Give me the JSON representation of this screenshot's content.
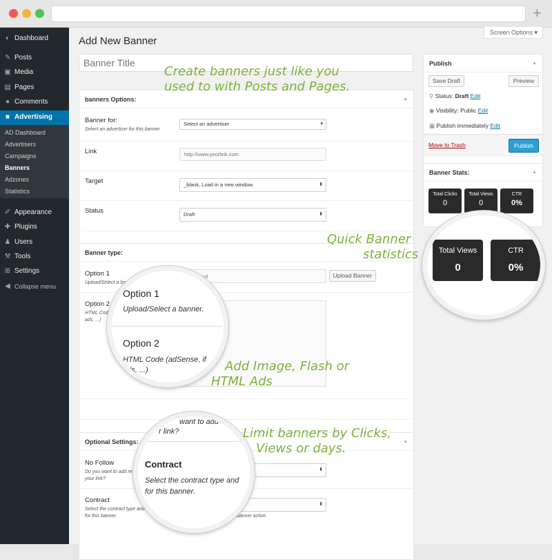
{
  "sidebar": {
    "items": [
      {
        "label": "Dashboard",
        "icon": "dashboard-icon",
        "glyph": "◐"
      },
      {
        "label": "Posts",
        "icon": "pin-icon",
        "glyph": "✎"
      },
      {
        "label": "Media",
        "icon": "media-icon",
        "glyph": "▣"
      },
      {
        "label": "Pages",
        "icon": "pages-icon",
        "glyph": "▤"
      },
      {
        "label": "Comments",
        "icon": "comments-icon",
        "glyph": "●"
      },
      {
        "label": "Advertising",
        "icon": "advertising-icon",
        "glyph": "■"
      },
      {
        "label": "Appearance",
        "icon": "brush-icon",
        "glyph": "✐"
      },
      {
        "label": "Plugins",
        "icon": "plugin-icon",
        "glyph": "✚"
      },
      {
        "label": "Users",
        "icon": "users-icon",
        "glyph": "♟"
      },
      {
        "label": "Tools",
        "icon": "wrench-icon",
        "glyph": "⚒"
      },
      {
        "label": "Settings",
        "icon": "settings-icon",
        "glyph": "⊞"
      },
      {
        "label": "Collapse menu",
        "icon": "collapse-icon",
        "glyph": "◀"
      }
    ],
    "submenu": [
      "AD Dashboard",
      "Advertisers",
      "Campaigns",
      "Banners",
      "Adzones",
      "Statistics"
    ]
  },
  "header": {
    "title": "Add New Banner",
    "screen_options": "Screen Options ▾"
  },
  "title_placeholder": "Banner Title",
  "options": {
    "header": "banners Options:",
    "banner_for": {
      "label": "Banner for:",
      "hint": "Select an advertiser for this banner.",
      "value": "Select an advertiser"
    },
    "link": {
      "label": "Link",
      "placeholder": "http://www.yourlink.com"
    },
    "target": {
      "label": "Target",
      "value": "_blank, Load in a new window."
    },
    "status": {
      "label": "Status",
      "value": "Draft"
    }
  },
  "type": {
    "header": "Banner type:",
    "opt1": {
      "label": "Option 1",
      "hint": "Upload/Select a banner",
      "placeholder": "Banner url",
      "button": "Upload Banner"
    },
    "opt2": {
      "label": "Option 2",
      "hint": "HTML Code (",
      "hint2": "ads, ...)"
    }
  },
  "optional": {
    "header": "Optional Settings:",
    "nofollow": {
      "label": "No Follow",
      "hint": "Do you want to add rel n",
      "hint2": "your link?"
    },
    "contract": {
      "label": "Contract",
      "hint": "Select the contract type and",
      "hint2": "for this banner.",
      "tail": "banner active."
    }
  },
  "publish": {
    "header": "Publish",
    "save": "Save Draft",
    "preview": "Preview",
    "status_label": "Status:",
    "status_value": "Draft",
    "vis_label": "Visibility:",
    "vis_value": "Public",
    "immediate": "Publish immediately",
    "edit": "Edit",
    "trash": "Move to Trash",
    "button": "Publish"
  },
  "stats": {
    "header": "Banner Stats:",
    "clicks_label": "Total Clicks",
    "clicks_value": "0",
    "views_label": "Total Views",
    "views_value": "0",
    "ctr_label": "CTR",
    "ctr_value": "0%"
  },
  "zoom1": {
    "l1": "Option 1",
    "h1": "Upload/Select a banner.",
    "l2": "Option 2",
    "h2": "HTML Code (adSense, if",
    "h3": "ads, ...)"
  },
  "zoom2": {
    "top": "want to add",
    "top2": "r link?",
    "label": "Contract",
    "h1": "Select the contract type and",
    "h2": "for this banner."
  },
  "annotations": {
    "a1": "Create banners just like you",
    "a2": "used to with Posts and Pages.",
    "a3": "Quick Banner",
    "a4": "statistics",
    "a5": "Add Image, Flash or",
    "a6": "HTML Ads",
    "a7": "Limit banners by Clicks,",
    "a8": "Views or days."
  },
  "colors": {
    "accent": "#0073aa",
    "sidebar": "#23282d",
    "annotation": "#7ab33a",
    "trash": "#a00"
  }
}
